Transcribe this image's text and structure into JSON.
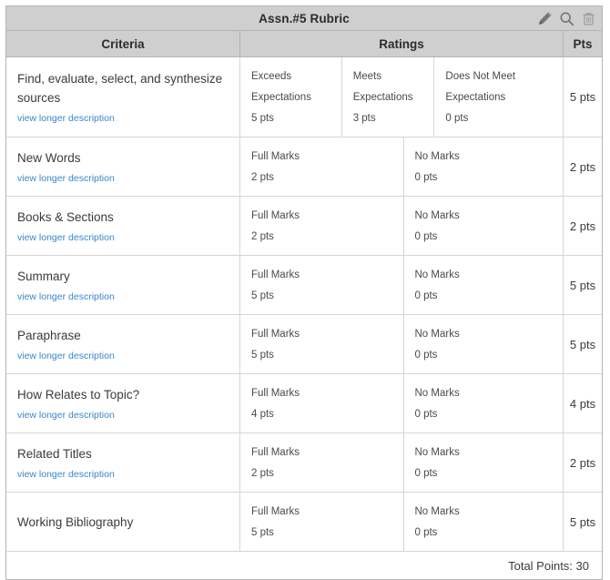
{
  "header": {
    "title": "Assn.#5 Rubric",
    "icons": [
      {
        "name": "edit-pencil-icon",
        "label": "Edit"
      },
      {
        "name": "search-icon",
        "label": "Find Rubric"
      },
      {
        "name": "trash-icon",
        "label": "Delete"
      }
    ]
  },
  "columns": {
    "criteria": "Criteria",
    "ratings": "Ratings",
    "pts": "Pts"
  },
  "link_label": "view longer description",
  "colors": {
    "header_bg": "#cfcfcf",
    "border": "#b4b4b4",
    "row_border": "#d6d6d6",
    "link": "#3b86c8",
    "text": "#3b3b3b"
  },
  "rows": [
    {
      "criteria": "Find, evaluate, select, and synthesize sources",
      "has_link": true,
      "ratings": [
        {
          "line1": "Exceeds",
          "line2": "Expectations",
          "pts": "5 pts"
        },
        {
          "line1": "Meets",
          "line2": "Expectations",
          "pts": "3 pts"
        },
        {
          "line1": "Does Not Meet",
          "line2": "Expectations",
          "pts": "0 pts"
        }
      ],
      "pts": "5 pts"
    },
    {
      "criteria": "New Words",
      "has_link": true,
      "ratings": [
        {
          "line1": "Full Marks",
          "line2": "",
          "pts": "2 pts"
        },
        {
          "line1": "No Marks",
          "line2": "",
          "pts": "0 pts"
        }
      ],
      "pts": "2 pts"
    },
    {
      "criteria": "Books & Sections",
      "has_link": true,
      "ratings": [
        {
          "line1": "Full Marks",
          "line2": "",
          "pts": "2 pts"
        },
        {
          "line1": "No Marks",
          "line2": "",
          "pts": "0 pts"
        }
      ],
      "pts": "2 pts"
    },
    {
      "criteria": "Summary",
      "has_link": true,
      "ratings": [
        {
          "line1": "Full Marks",
          "line2": "",
          "pts": "5 pts"
        },
        {
          "line1": "No Marks",
          "line2": "",
          "pts": "0 pts"
        }
      ],
      "pts": "5 pts"
    },
    {
      "criteria": "Paraphrase",
      "has_link": true,
      "ratings": [
        {
          "line1": "Full Marks",
          "line2": "",
          "pts": "5 pts"
        },
        {
          "line1": "No Marks",
          "line2": "",
          "pts": "0 pts"
        }
      ],
      "pts": "5 pts"
    },
    {
      "criteria": "How Relates to Topic?",
      "has_link": true,
      "ratings": [
        {
          "line1": "Full Marks",
          "line2": "",
          "pts": "4 pts"
        },
        {
          "line1": "No Marks",
          "line2": "",
          "pts": "0 pts"
        }
      ],
      "pts": "4 pts"
    },
    {
      "criteria": "Related Titles",
      "has_link": true,
      "ratings": [
        {
          "line1": "Full Marks",
          "line2": "",
          "pts": "2 pts"
        },
        {
          "line1": "No Marks",
          "line2": "",
          "pts": "0 pts"
        }
      ],
      "pts": "2 pts"
    },
    {
      "criteria": "Working Bibliography",
      "has_link": false,
      "ratings": [
        {
          "line1": "Full Marks",
          "line2": "",
          "pts": "5 pts"
        },
        {
          "line1": "No Marks",
          "line2": "",
          "pts": "0 pts"
        }
      ],
      "pts": "5 pts"
    }
  ],
  "footer": {
    "total_points": "Total Points: 30"
  }
}
